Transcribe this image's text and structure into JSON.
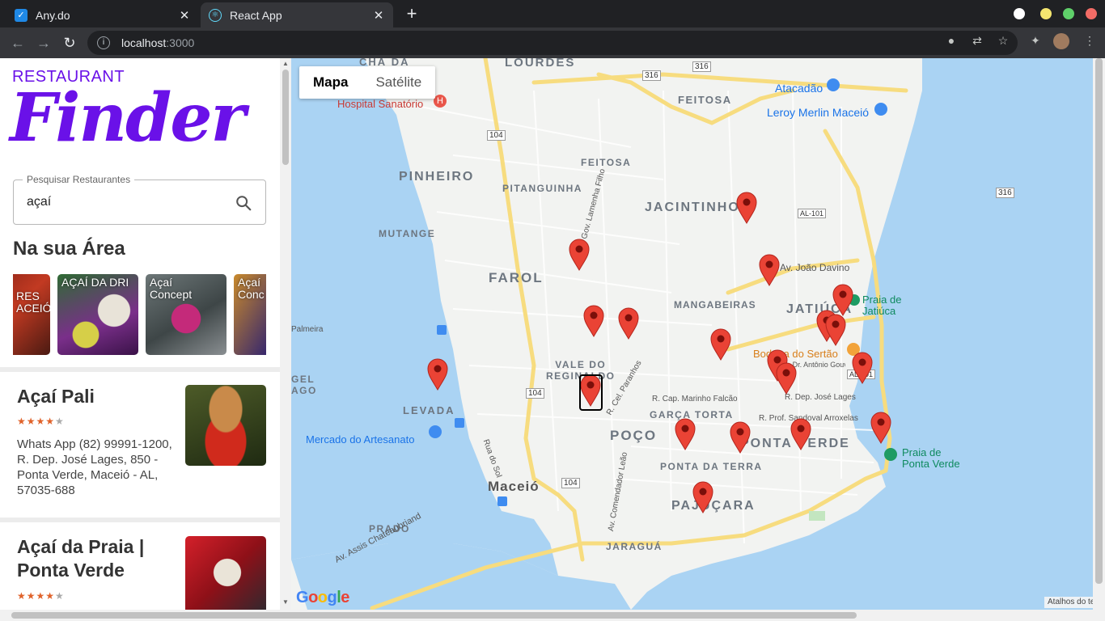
{
  "browser": {
    "tabs": [
      {
        "title": "Any.do",
        "close": "✕"
      },
      {
        "title": "React App",
        "close": "✕"
      }
    ],
    "new_tab": "+",
    "url_host": "localhost",
    "url_port": ":3000",
    "controls": {
      "back": "←",
      "forward": "→",
      "reload": "↻",
      "info": "i"
    }
  },
  "sidebar": {
    "brand_small": "RESTAURANT",
    "brand_big": "Finder",
    "search": {
      "legend": "Pesquisar Restaurantes",
      "value": "açaí"
    },
    "area_title": "Na sua Área",
    "thumbs": [
      {
        "label": "RES\nACEIÓ"
      },
      {
        "label": "AÇAÍ DA DRI"
      },
      {
        "label": "Açaí\nConcept"
      },
      {
        "label": "Açaí\nConc"
      }
    ],
    "cards": [
      {
        "name": "Açaí Pali",
        "stars": "★★★★★",
        "rating": 4.5,
        "address": "Whats App (82) 99991-1200, R. Dep. José Lages, 850 - Ponta Verde, Maceió - AL, 57035-688"
      },
      {
        "name": "Açaí da Praia | Ponta Verde",
        "stars": "★★★★★",
        "rating": 4.2,
        "address": ""
      }
    ]
  },
  "map": {
    "type_buttons": {
      "map": "Mapa",
      "satellite": "Satélite"
    },
    "attribution": "Google",
    "shortcuts": "Atalhos do teclado",
    "labels": {
      "lourdes": "LOURDES",
      "cha_da": "CHÃ DA",
      "hospital": "Hospital Sanatório",
      "feitosa": "FEITOSA",
      "atacadao": "Atacadão",
      "leroy": "Leroy Merlin Maceió",
      "pinheiro": "PINHEIRO",
      "feitosa2": "FEITOSA",
      "pitanguinha": "PITANGUINHA",
      "jacintinho": "JACINTINHO",
      "mutange": "MUTANGE",
      "farol": "FAROL",
      "joao_davino": "Av. João Davino",
      "mangabeiras": "MANGABEIRAS",
      "jatiuca": "JATIÚCA",
      "praia_jatiuca": "Praia de\nJatiúca",
      "vale": "VALE DO\nREGINALDO",
      "bodega": "Bodega do Sertão",
      "palmeira": "Palmeira",
      "gel": "GEL\nAGO",
      "levada": "LEVADA",
      "marinho": "R. Cap. Marinho Falcão",
      "garca": "GARÇA TORTA",
      "jose_lages": "R. Dep. José Lages",
      "arroxelas": "R. Prof. Sandoval Arroxelas",
      "mercado": "Mercado do Artesanato",
      "poco": "POÇO",
      "ponta_verde": "PONTA VERDE",
      "praia_pv": "Praia de\nPonta Verde",
      "ponta_terra": "PONTA DA TERRA",
      "maceio": "Maceió",
      "pajucara": "PAJUÇARA",
      "prado": "PRADO",
      "jaragua": "JARAGUÁ",
      "assis": "Av. Assis Chateaubriand",
      "comendador": "Av. Comendador Leão",
      "sol": "Rua do Sol",
      "parana": "R. Cel. Paranhos",
      "lamenha": "Gov. Lamenha Filho",
      "marques": "Av. Dr. Antônio Gouveia / Marques Luz",
      "r104a": "104",
      "r104b": "104",
      "r104c": "104",
      "r316a": "316",
      "r316b": "316",
      "r316c": "316",
      "al101a": "AL-101",
      "al101b": "AL-101"
    }
  }
}
